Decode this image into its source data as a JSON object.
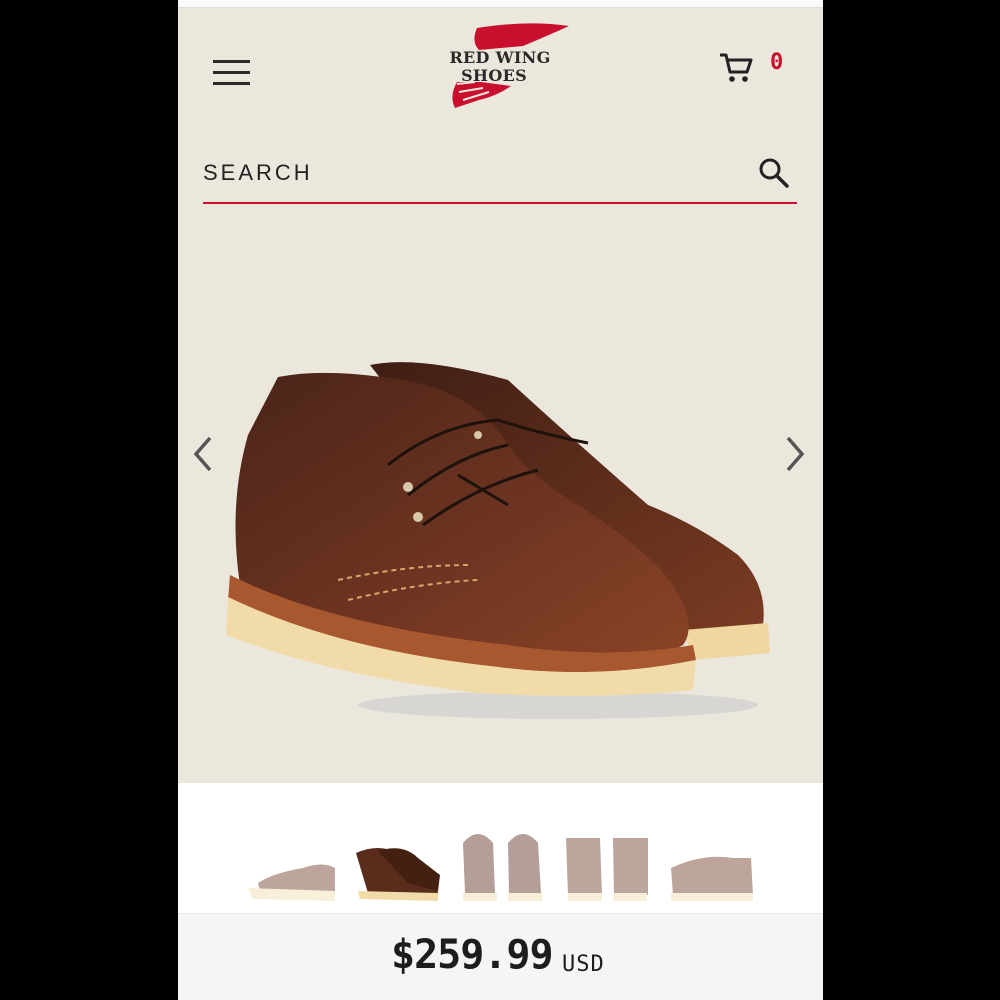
{
  "header": {
    "brand_line1": "RED WING",
    "brand_line2": "SHOES",
    "brand_color": "#c8102e",
    "cart_count": "0",
    "menu_icon": "hamburger-menu-icon",
    "cart_icon": "shopping-cart-icon"
  },
  "search": {
    "placeholder": "SEARCH",
    "icon": "magnifier-icon"
  },
  "gallery": {
    "prev_icon": "chevron-left-icon",
    "next_icon": "chevron-right-icon",
    "thumbnail_count": 5,
    "selected_thumbnail": 2
  },
  "price": {
    "amount": "$259.99",
    "currency": "USD"
  }
}
